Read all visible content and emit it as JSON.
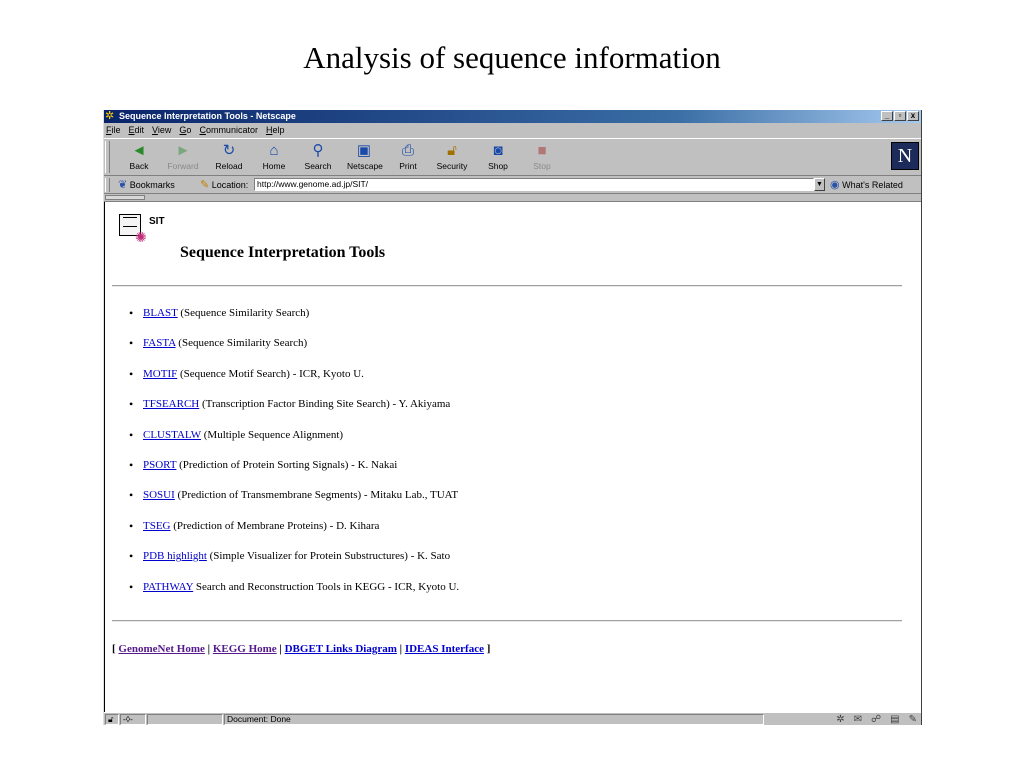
{
  "slide": {
    "title": "Analysis of sequence information"
  },
  "window": {
    "title": "Sequence Interpretation Tools - Netscape",
    "controls": {
      "minimize": "_",
      "maximize": "▫",
      "close": "x"
    }
  },
  "menu": [
    {
      "accel": "F",
      "rest": "ile"
    },
    {
      "accel": "E",
      "rest": "dit"
    },
    {
      "accel": "V",
      "rest": "iew"
    },
    {
      "accel": "G",
      "rest": "o"
    },
    {
      "accel": "C",
      "rest": "ommunicator"
    },
    {
      "accel": "H",
      "rest": "elp"
    }
  ],
  "toolbar": {
    "back": "Back",
    "forward": "Forward",
    "reload": "Reload",
    "home": "Home",
    "search": "Search",
    "netscape": "Netscape",
    "print": "Print",
    "security": "Security",
    "shop": "Shop",
    "stop": "Stop",
    "logo": "N"
  },
  "location_bar": {
    "bookmarks": "Bookmarks",
    "location_label": "Location:",
    "url": "http://www.genome.ad.jp/SIT/",
    "related": "What's Related"
  },
  "page": {
    "logo_text": "SIT",
    "heading": "Sequence Interpretation Tools",
    "tools": [
      {
        "link": "BLAST",
        "desc": " (Sequence Similarity Search)"
      },
      {
        "link": "FASTA",
        "desc": " (Sequence Similarity Search)"
      },
      {
        "link": "MOTIF",
        "desc": " (Sequence Motif Search) - ICR, Kyoto U."
      },
      {
        "link": "TFSEARCH",
        "desc": " (Transcription Factor Binding Site Search) - Y. Akiyama"
      },
      {
        "link": "CLUSTALW",
        "desc": " (Multiple Sequence Alignment)"
      },
      {
        "link": "PSORT",
        "desc": " (Prediction of Protein Sorting Signals) - K. Nakai"
      },
      {
        "link": "SOSUI",
        "desc": " (Prediction of Transmembrane Segments) - Mitaku Lab., TUAT"
      },
      {
        "link": "TSEG",
        "desc": " (Prediction of Membrane Proteins) - D. Kihara"
      },
      {
        "link": "PDB highlight",
        "desc": " (Simple Visualizer for Protein Substructures) - K. Sato"
      },
      {
        "link": "PATHWAY",
        "desc": " Search and Reconstruction Tools in KEGG - ICR, Kyoto U."
      }
    ],
    "footer": {
      "open": "[ ",
      "sep": " | ",
      "close": " ]",
      "genomenet": "GenomeNet Home",
      "kegg": "KEGG Home",
      "dbget": "DBGET Links Diagram",
      "ideas": "IDEAS Interface"
    }
  },
  "status": {
    "text": "Document: Done"
  },
  "colors": {
    "link": "#0000cc",
    "visited": "#551a8b",
    "titlebar": "#0a246a",
    "chrome": "#c0c0c0"
  }
}
